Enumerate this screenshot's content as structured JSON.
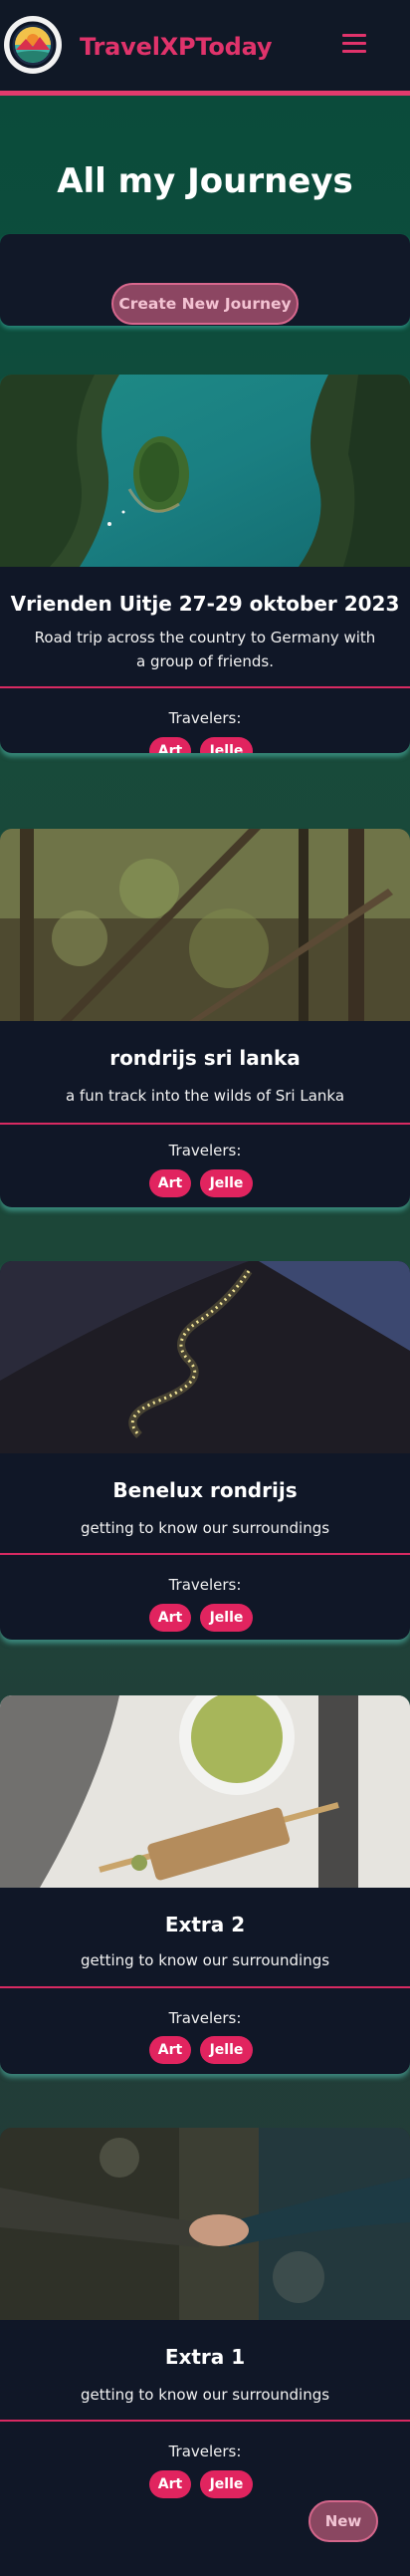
{
  "header": {
    "brand": "TravelXPToday",
    "logo_icon": "landscape-logo-icon",
    "menu_icon": "hamburger-menu-icon",
    "accent_color": "#e0336b"
  },
  "hero": {
    "title": "All my Journeys",
    "create_button": "Create New Journey"
  },
  "journeys": [
    {
      "title": "Vrienden Uitje 27-29 oktober 2023",
      "description": "Road trip across the country to Germany with a group of friends.",
      "travelers_label": "Travelers:",
      "travelers": [
        "Art",
        "Jelle"
      ]
    },
    {
      "title": "rondrijs sri lanka",
      "description": "a fun track into the wilds of Sri Lanka",
      "travelers_label": "Travelers:",
      "travelers": [
        "Art",
        "Jelle"
      ]
    },
    {
      "title": "Benelux rondrijs",
      "description": "getting to know our surroundings",
      "travelers_label": "Travelers:",
      "travelers": [
        "Art",
        "Jelle"
      ]
    },
    {
      "title": "Extra 2",
      "description": "getting to know our surroundings",
      "travelers_label": "Travelers:",
      "travelers": [
        "Art",
        "Jelle"
      ]
    },
    {
      "title": "Extra 1",
      "description": "getting to know our surroundings",
      "travelers_label": "Travelers:",
      "travelers": [
        "Art",
        "Jelle"
      ]
    }
  ],
  "fab": {
    "label": "New"
  }
}
